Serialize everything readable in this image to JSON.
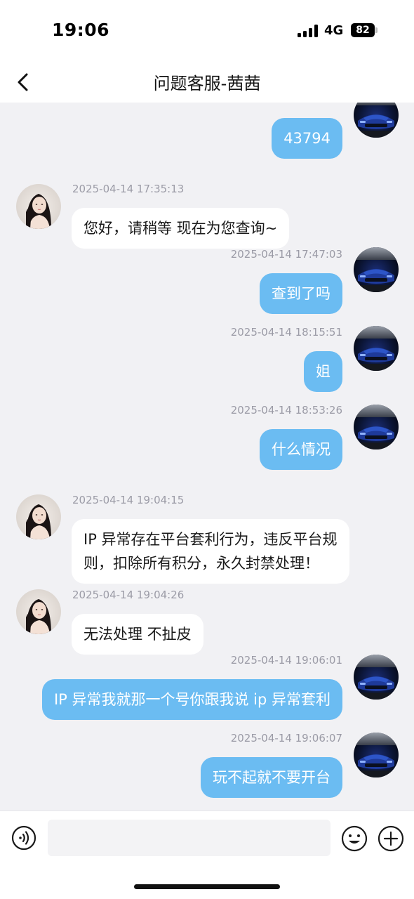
{
  "status_bar": {
    "time": "19:06",
    "network": "4G",
    "battery": "82"
  },
  "header": {
    "title": "问题客服-茜茜"
  },
  "messages": [
    {
      "direction": "out",
      "text": "43794"
    },
    {
      "direction": "in",
      "time": "2025-04-14 17:35:13",
      "text": "您好，请稍等 现在为您查询~"
    },
    {
      "direction": "out",
      "time": "2025-04-14 17:47:03",
      "text": "查到了吗"
    },
    {
      "direction": "out",
      "time": "2025-04-14 18:15:51",
      "text": "姐"
    },
    {
      "direction": "out",
      "time": "2025-04-14 18:53:26",
      "text": "什么情况"
    },
    {
      "direction": "in",
      "time": "2025-04-14 19:04:15",
      "text_lines": [
        "IP 异常存在平台套利行为，违反平台规",
        "则，扣除所有积分，永久封禁处理！"
      ]
    },
    {
      "direction": "in",
      "time": "2025-04-14 19:04:26",
      "text": "无法处理  不扯皮"
    },
    {
      "direction": "out",
      "time": "2025-04-14 19:06:01",
      "text": "IP 异常我就那一个号你跟我说 ip 异常套利"
    },
    {
      "direction": "out",
      "time": "2025-04-14 19:06:07",
      "text": "玩不起就不要开台"
    }
  ],
  "input": {
    "value": "",
    "placeholder": ""
  },
  "icons": {
    "back": "chevron-left-icon",
    "voice": "voice-icon",
    "emoji": "emoji-icon",
    "plus": "plus-icon"
  },
  "colors": {
    "outgoing_bubble": "#6bbcf2",
    "incoming_bubble": "#ffffff",
    "chat_background": "#f1f1f4",
    "timestamp": "#9b9ba6"
  }
}
